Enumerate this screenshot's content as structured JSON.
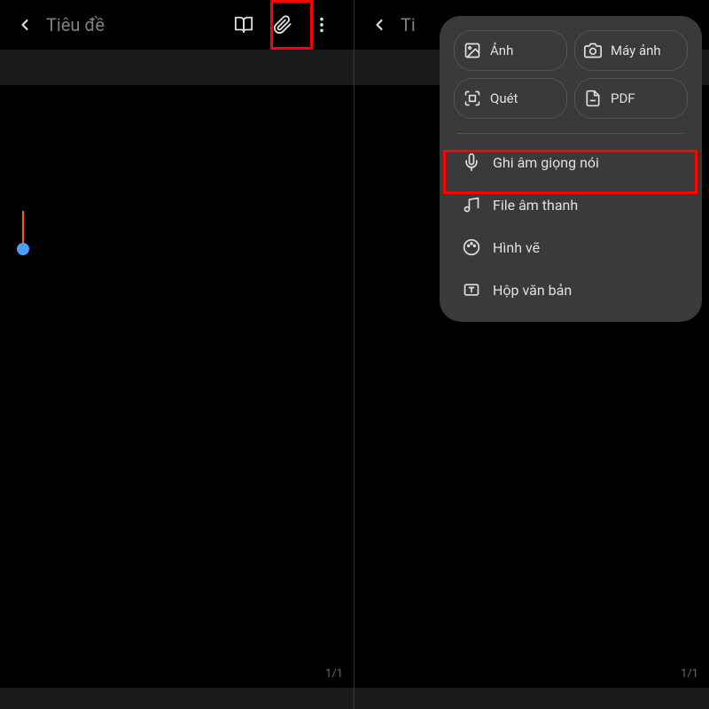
{
  "left_screen": {
    "title": "Tiêu đề",
    "page_indicator": "1/1"
  },
  "right_screen": {
    "title": "Ti",
    "page_indicator": "1/1",
    "popup": {
      "grid": [
        {
          "label": "Ảnh",
          "icon": "image-icon"
        },
        {
          "label": "Máy ảnh",
          "icon": "camera-icon"
        },
        {
          "label": "Quét",
          "icon": "scan-icon"
        },
        {
          "label": "PDF",
          "icon": "pdf-icon"
        }
      ],
      "list": [
        {
          "label": "Ghi âm giọng nói",
          "icon": "mic-icon"
        },
        {
          "label": "File âm thanh",
          "icon": "music-icon"
        },
        {
          "label": "Hình vẽ",
          "icon": "palette-icon"
        },
        {
          "label": "Hộp văn bản",
          "icon": "textbox-icon"
        }
      ]
    }
  }
}
